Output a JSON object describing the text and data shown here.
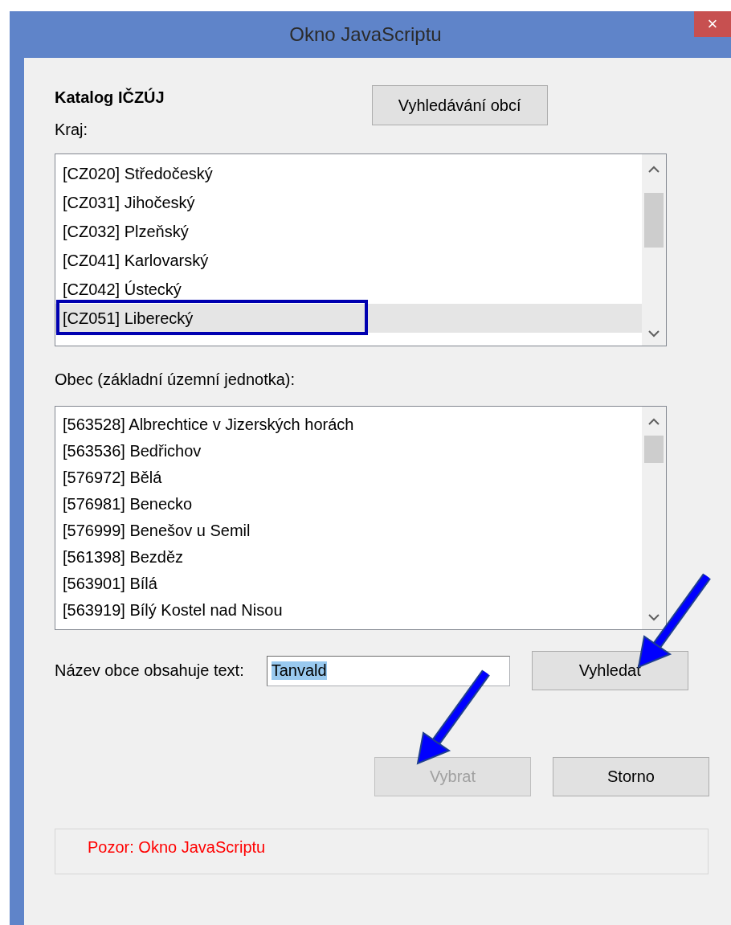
{
  "window": {
    "title": "Okno JavaScriptu",
    "close": "×"
  },
  "heading": "Katalog IČZÚJ",
  "search_button": {
    "label": "Vyhledávání obcí"
  },
  "kraj": {
    "label": "Kraj:",
    "items": [
      {
        "text": "[CZ020] Středočeský",
        "selected": false
      },
      {
        "text": "[CZ031] Jihočeský",
        "selected": false
      },
      {
        "text": "[CZ032] Plzeňský",
        "selected": false
      },
      {
        "text": "[CZ041] Karlovarský",
        "selected": false
      },
      {
        "text": "[CZ042] Ústecký",
        "selected": false
      },
      {
        "text": "[CZ051] Liberecký",
        "selected": true
      }
    ]
  },
  "obec": {
    "label": "Obec (základní územní jednotka):",
    "items": [
      {
        "text": "[563528] Albrechtice v Jizerských horách",
        "selected": false
      },
      {
        "text": "[563536] Bedřichov",
        "selected": false
      },
      {
        "text": "[576972] Bělá",
        "selected": false
      },
      {
        "text": "[576981] Benecko",
        "selected": false
      },
      {
        "text": "[576999] Benešov u Semil",
        "selected": false
      },
      {
        "text": "[561398] Bezděz",
        "selected": false
      },
      {
        "text": "[563901] Bílá",
        "selected": false
      },
      {
        "text": "[563919] Bílý Kostel nad Nisou",
        "selected": false
      }
    ]
  },
  "filter": {
    "label": "Název obce obsahuje text:",
    "value": "Tanvald",
    "value_selected": true
  },
  "buttons": [
    {
      "label": "Vyhledat",
      "disabled": false
    },
    {
      "label": "Vybrat",
      "disabled": true
    },
    {
      "label": "Storno",
      "disabled": false
    }
  ],
  "status": "Pozor: Okno JavaScriptu"
}
